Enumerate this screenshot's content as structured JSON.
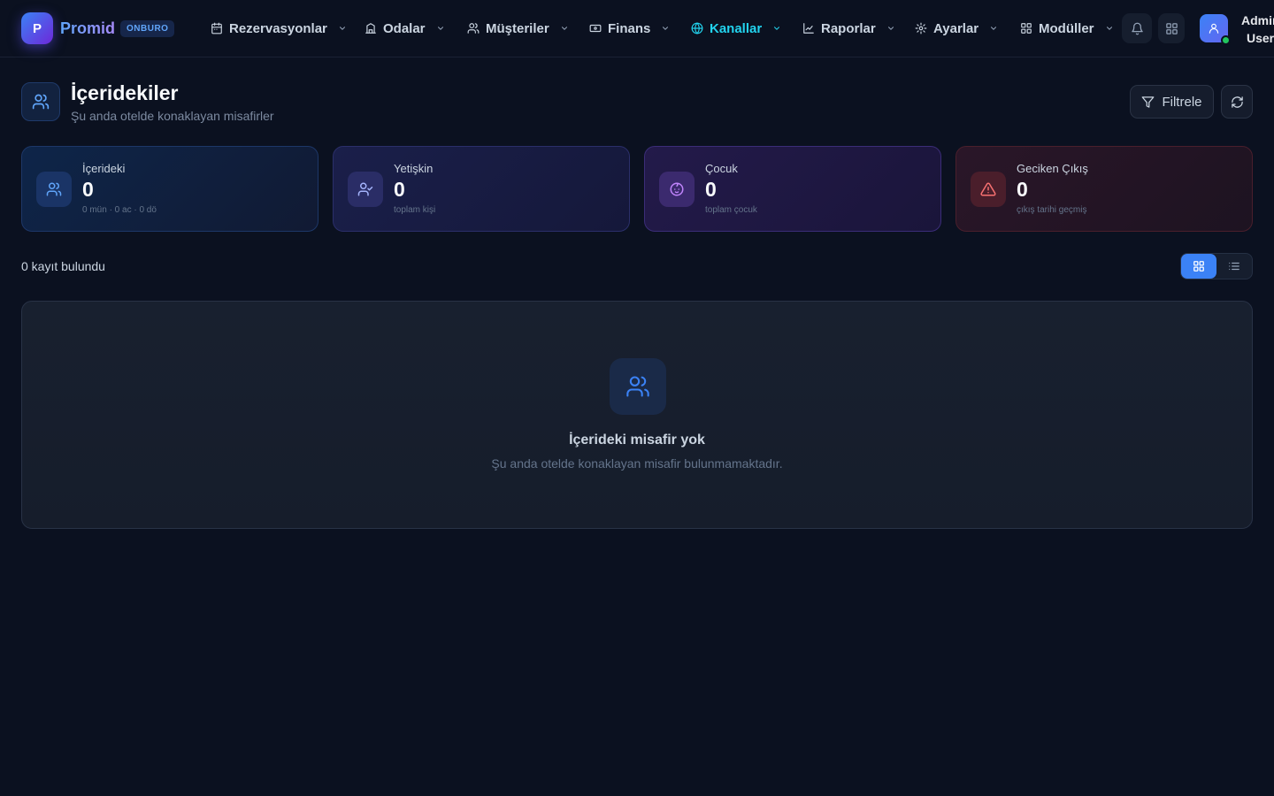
{
  "header": {
    "logo_letter": "P",
    "brand": "Promid",
    "badge": "ONBURO",
    "nav": [
      {
        "label": "Rezervasyonlar",
        "icon": "calendar-icon"
      },
      {
        "label": "Odalar",
        "icon": "building-icon"
      },
      {
        "label": "Müşteriler",
        "icon": "users-icon"
      },
      {
        "label": "Finans",
        "icon": "money-icon"
      },
      {
        "label": "Kanallar",
        "icon": "globe-icon",
        "active": true
      },
      {
        "label": "Raporlar",
        "icon": "chart-icon"
      },
      {
        "label": "Ayarlar",
        "icon": "gear-icon"
      },
      {
        "label": "Modüller",
        "icon": "grid-icon"
      }
    ],
    "user_line1": "Admin",
    "user_line2": "User"
  },
  "page": {
    "title": "İçeridekiler",
    "subtitle": "Şu anda otelde konaklayan misafirler",
    "filter_label": "Filtrele"
  },
  "stats": [
    {
      "label": "İçerideki",
      "value": "0",
      "note": "0 mün · 0 ac · 0 dö",
      "icon": "users-icon"
    },
    {
      "label": "Yetişkin",
      "value": "0",
      "note": "toplam kişi",
      "icon": "user-check-icon"
    },
    {
      "label": "Çocuk",
      "value": "0",
      "note": "toplam çocuk",
      "icon": "baby-icon"
    },
    {
      "label": "Geciken Çıkış",
      "value": "0",
      "note": "çıkış tarihi geçmiş",
      "icon": "warning-icon"
    }
  ],
  "list": {
    "count_text": "0 kayıt bulundu",
    "view_mode": "grid"
  },
  "empty_state": {
    "title": "İçerideki misafir yok",
    "subtitle": "Şu anda otelde konaklayan misafir bulunmamaktadır."
  },
  "colors": {
    "background": "#0b1120",
    "accent": "#3b82f6",
    "active_nav": "#22d3ee",
    "danger": "#ef4444"
  }
}
